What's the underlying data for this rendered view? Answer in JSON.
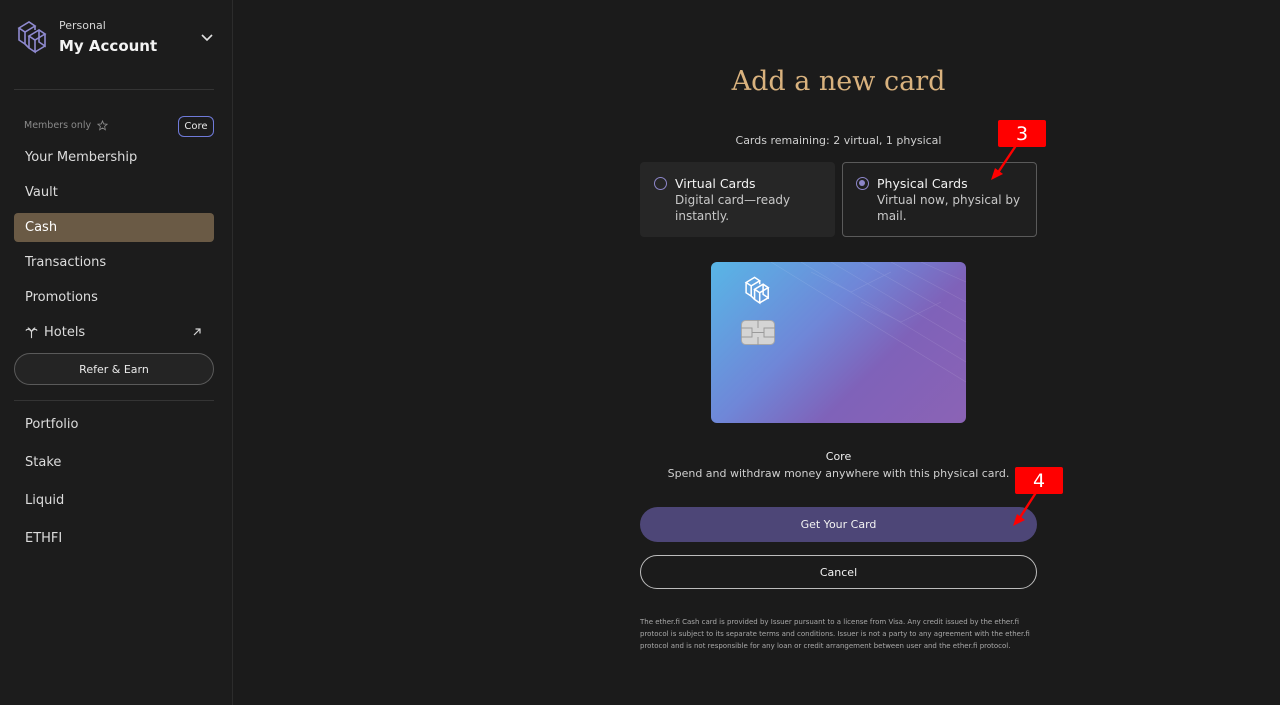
{
  "account": {
    "type": "Personal",
    "name": "My Account"
  },
  "sidebar": {
    "members_only": "Members only",
    "badge": "Core",
    "items": [
      {
        "label": "Your Membership"
      },
      {
        "label": "Vault"
      },
      {
        "label": "Cash",
        "active": true
      },
      {
        "label": "Transactions"
      },
      {
        "label": "Promotions"
      },
      {
        "label": "Hotels"
      }
    ],
    "refer": "Refer & Earn",
    "secondary": [
      {
        "label": "Portfolio"
      },
      {
        "label": "Stake"
      },
      {
        "label": "Liquid"
      },
      {
        "label": "ETHFI"
      }
    ]
  },
  "main": {
    "title": "Add a new card",
    "remaining": "Cards remaining: 2 virtual, 1 physical",
    "options": [
      {
        "title": "Virtual Cards",
        "desc": "Digital card—ready instantly.",
        "selected": false
      },
      {
        "title": "Physical Cards",
        "desc": "Virtual now, physical by mail.",
        "selected": true
      }
    ],
    "card_name": "Core",
    "card_desc": "Spend and withdraw money anywhere with this physical card.",
    "get_button": "Get Your Card",
    "cancel_button": "Cancel",
    "disclaimer": "The ether.fi Cash card is provided by Issuer pursuant to a license from Visa. Any credit issued by the ether.fi protocol is subject to its separate terms and conditions. Issuer is not a party to any agreement with the ether.fi protocol and is not responsible for any loan or credit arrangement between user and the ether.fi protocol."
  },
  "annotations": {
    "step3": "3",
    "step4": "4"
  },
  "colors": {
    "background": "#1b1b1b",
    "accent_gold": "#d9b27e",
    "active_nav": "#6a5a45",
    "primary_button": "#4d4677",
    "annotation": "#ff0000"
  }
}
